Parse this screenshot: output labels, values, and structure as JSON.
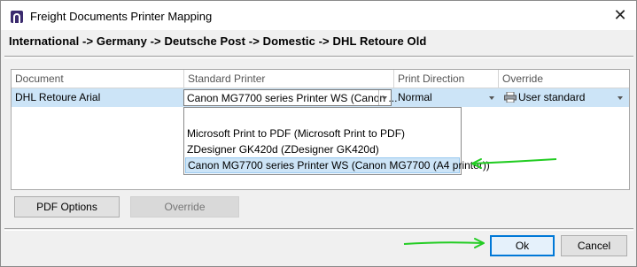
{
  "window": {
    "title": "Freight Documents Printer Mapping",
    "close_glyph": "✕"
  },
  "breadcrumb": "International -> Germany -> Deutsche Post -> Domestic -> DHL Retoure Old",
  "grid": {
    "columns": [
      "Document",
      "Standard Printer",
      "Print Direction",
      "Override"
    ],
    "rows": [
      {
        "document": "DHL Retoure Arial",
        "standard_printer": "Canon MG7700 series Printer WS (Canon ...",
        "print_direction": "Normal",
        "override": "User standard"
      }
    ]
  },
  "printer_dropdown": {
    "options": [
      "",
      "Microsoft Print to PDF (Microsoft Print to PDF)",
      "ZDesigner GK420d (ZDesigner GK420d)",
      "Canon MG7700 series Printer WS (Canon MG7700 (A4 printer))"
    ],
    "selected_index": 3
  },
  "buttons": {
    "pdf_options": "PDF Options",
    "override": "Override",
    "ok": "Ok",
    "cancel": "Cancel"
  },
  "icons": {
    "app": "app-logo-icon",
    "override_cell": "printer-icon",
    "dropdown_arrow": "chevron-down-icon"
  },
  "colors": {
    "selection": "#cce4f7",
    "focus_border": "#0078d7",
    "annotation_arrow": "#22cc22"
  }
}
